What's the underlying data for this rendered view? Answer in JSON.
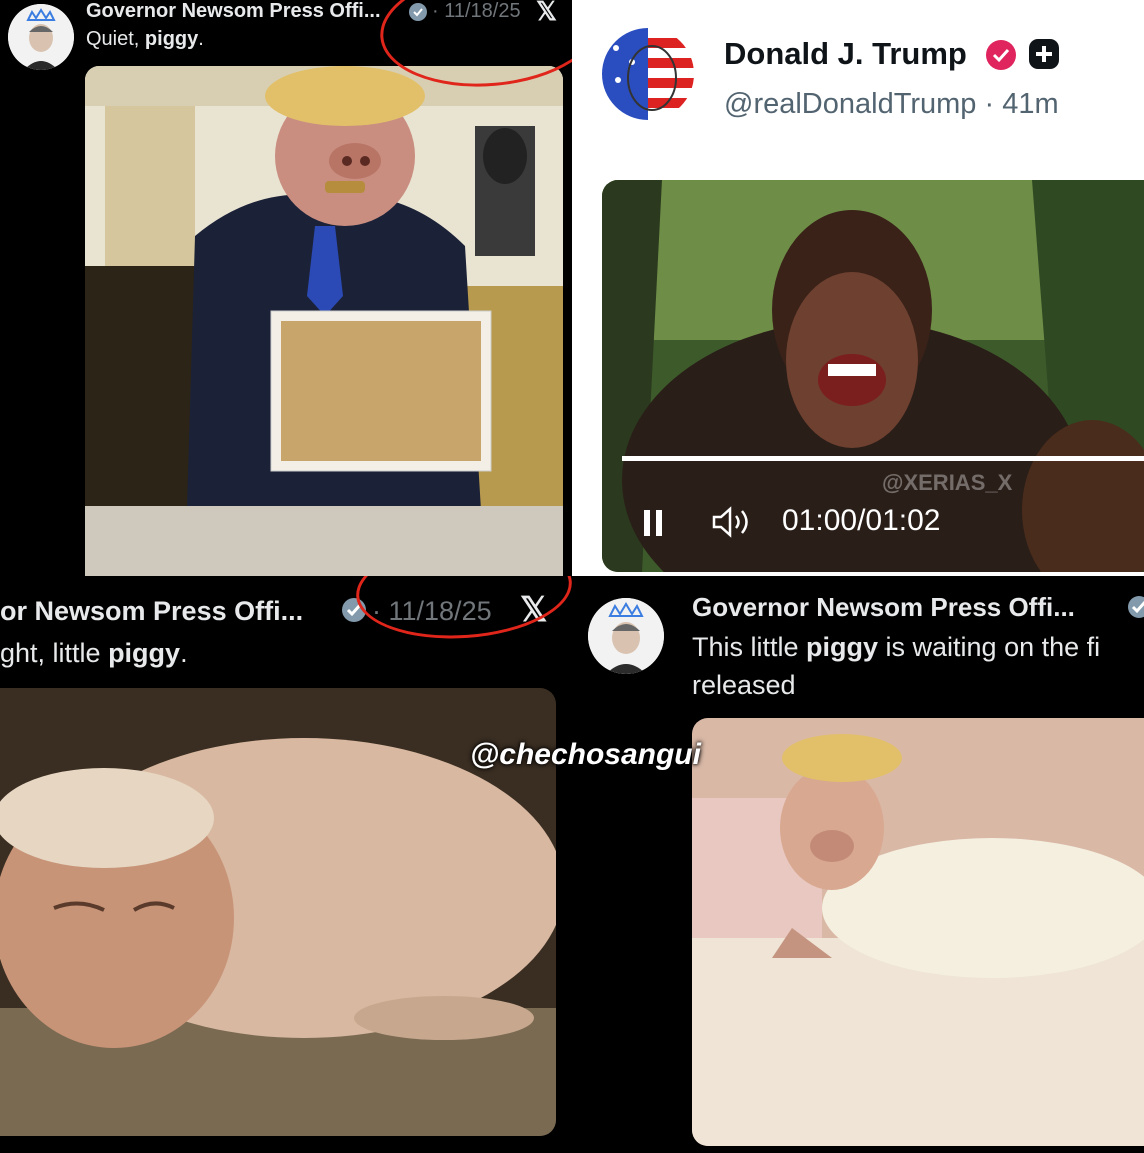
{
  "posts": {
    "top_left": {
      "author": "Governor Newsom Press Offi...",
      "date": "11/18/25",
      "text_prefix": "Quiet, ",
      "text_bold": "piggy",
      "text_suffix": "."
    },
    "top_right": {
      "author": "Donald J. Trump",
      "handle": "@realDonaldTrump",
      "sep": "·",
      "time": "41m",
      "video": {
        "watermark": "@XERIAS_X",
        "time_display": "01:00/01:02",
        "progress": 0.97
      }
    },
    "bottom_left": {
      "author": "or Newsom Press Offi...",
      "date": "11/18/25",
      "text_prefix": "ght, little ",
      "text_bold": "piggy",
      "text_suffix": "."
    },
    "bottom_right": {
      "author": "Governor Newsom Press Offi...",
      "line1_prefix": "This little ",
      "line1_bold": "piggy",
      "line1_suffix": " is waiting on the fi",
      "line2": "released"
    }
  },
  "watermark": "@chechosangui",
  "colors": {
    "annotation_red": "#e0251b",
    "verified_pink": "#e0245e"
  }
}
